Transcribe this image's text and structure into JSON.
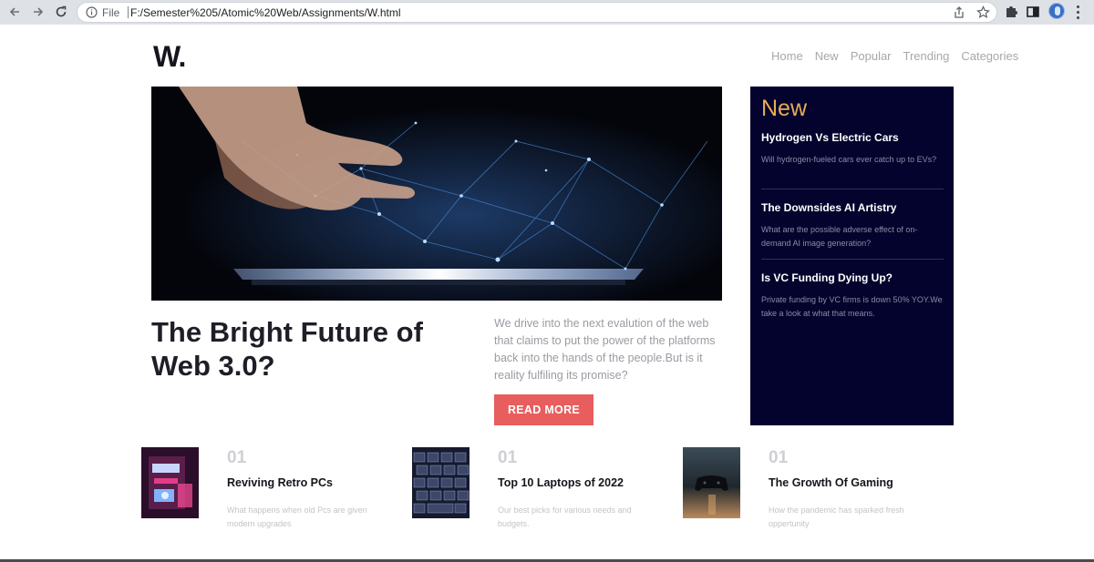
{
  "browser": {
    "file_label": "File",
    "url": "F:/Semester%205/Atomic%20Web/Assignments/W.html"
  },
  "site": {
    "logo": "W.",
    "nav": [
      "Home",
      "New",
      "Popular",
      "Trending",
      "Categories"
    ]
  },
  "featured": {
    "headline": "The Bright Future of Web 3.0?",
    "lede": "We drive into the next evalution of the web that claims to put the power of the platforms back into the hands of the people.But is it reality fulfiling its promise?",
    "cta": "READ MORE"
  },
  "new_panel": {
    "title": "New",
    "items": [
      {
        "title": "Hydrogen Vs Electric Cars",
        "desc": "Will hydrogen-fueled cars ever catch up to EVs?"
      },
      {
        "title": "The Downsides AI Artistry",
        "desc": "What are the possible adverse effect of on-demand AI image generation?"
      },
      {
        "title": "Is VC Funding Dying Up?",
        "desc": "Private funding by VC firms is down 50% YOY.We take a look at what that means."
      }
    ]
  },
  "cards": [
    {
      "num": "01",
      "title": "Reviving Retro PCs",
      "desc": "What happens when old Pcs are given modern upgrades"
    },
    {
      "num": "01",
      "title": "Top 10 Laptops of 2022",
      "desc": "Our best picks for various needs and budgets."
    },
    {
      "num": "01",
      "title": "The Growth Of Gaming",
      "desc": "How the pandemic has sparked fresh oppertunity"
    }
  ],
  "colors": {
    "accent_button": "#e85d5d",
    "panel_bg": "#03032e",
    "panel_title": "#e9ab55"
  }
}
